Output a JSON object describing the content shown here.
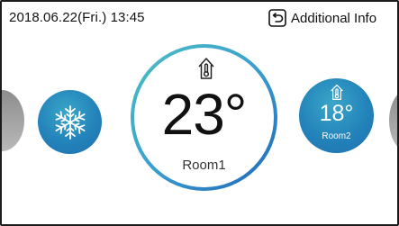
{
  "header": {
    "datetime": "2018.06.22(Fri.) 13:45",
    "additional_info_label": "Additional Info"
  },
  "icons": {
    "back": "return-arrow-icon",
    "mode": "snowflake-icon",
    "room": "house-thermometer-icon"
  },
  "main_room": {
    "temperature": "23°",
    "name": "Room1"
  },
  "room2": {
    "temperature": "18°",
    "name": "Room2"
  },
  "colors": {
    "accent_blue": "#2383ba",
    "dial_gradient_start": "#4cc0c0",
    "dial_gradient_end": "#2066b8",
    "side_gray": "#9a9a9a"
  }
}
